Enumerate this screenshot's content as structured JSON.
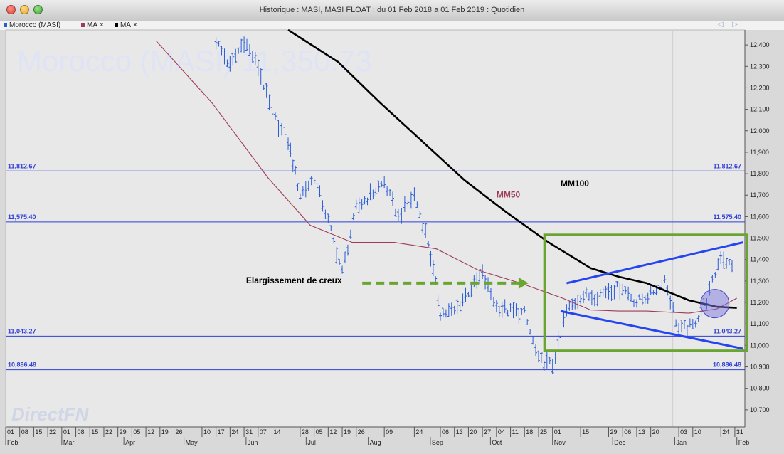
{
  "window": {
    "title": "Historique : MASI, MASI FLOAT : du 01 Feb 2018 a 01 Feb 2019 : Quotidien"
  },
  "legend": {
    "items": [
      {
        "label": "Morocco (MASI)",
        "color": "#2a5bd7"
      },
      {
        "label": "MA",
        "close": "×",
        "color": "#9e3b58"
      },
      {
        "label": "MA",
        "close": "×",
        "color": "#000000"
      }
    ],
    "nav": "◁ ▷"
  },
  "chart_data": {
    "type": "line",
    "title": "Morocco (MASI) 11,350.73",
    "brand": "DirectFN",
    "ylim": [
      10620,
      12470
    ],
    "yticks": [
      12400,
      12300,
      12200,
      12100,
      12000,
      11900,
      11800,
      11700,
      11600,
      11500,
      11400,
      11300,
      11200,
      11100,
      11000,
      10900,
      10800,
      10700
    ],
    "ytick_labels": [
      "12,400",
      "12,300",
      "12,200",
      "12,100",
      "12,000",
      "11,900",
      "11,800",
      "11,700",
      "11,600",
      "11,500",
      "11,400",
      "11,300",
      "11,200",
      "11,100",
      "11,000",
      "10,900",
      "10,800",
      "10,700"
    ],
    "x_day_ticks": [
      "01",
      "08",
      "15",
      "22",
      "01",
      "08",
      "15",
      "22",
      "29",
      "05",
      "12",
      "19",
      "26",
      "10",
      "17",
      "24",
      "31",
      "07",
      "14",
      "28",
      "05",
      "12",
      "19",
      "26",
      "09",
      "24",
      "06",
      "13",
      "20",
      "27",
      "04",
      "11",
      "18",
      "25",
      "01",
      "15",
      "29",
      "06",
      "13",
      "20",
      "03",
      "10",
      "24",
      "31"
    ],
    "x_months": [
      "Feb",
      "Mar",
      "Apr",
      "May",
      "Jun",
      "Jul",
      "Aug",
      "Sep",
      "Oct",
      "Nov",
      "Dec",
      "Jan",
      "Feb"
    ],
    "levels": [
      {
        "value": 11812.67,
        "label": "11,812.67"
      },
      {
        "value": 11575.4,
        "label": "11,575.40"
      },
      {
        "value": 11043.27,
        "label": "11,043.27"
      },
      {
        "value": 10886.48,
        "label": "10,886.48"
      }
    ],
    "series": [
      {
        "name": "Morocco (MASI)",
        "style": "ohlc",
        "color": "#2a5bd7",
        "x": [
          "2018-05-17",
          "2018-05-24",
          "2018-05-31",
          "2018-06-07",
          "2018-06-14",
          "2018-06-22",
          "2018-06-28",
          "2018-07-05",
          "2018-07-12",
          "2018-07-19",
          "2018-07-26",
          "2018-08-02",
          "2018-08-09",
          "2018-08-16",
          "2018-08-24",
          "2018-08-31",
          "2018-09-06",
          "2018-09-13",
          "2018-09-20",
          "2018-09-27",
          "2018-10-04",
          "2018-10-11",
          "2018-10-18",
          "2018-10-25",
          "2018-11-01",
          "2018-11-08",
          "2018-11-15",
          "2018-11-22",
          "2018-11-29",
          "2018-12-06",
          "2018-12-13",
          "2018-12-20",
          "2018-12-27",
          "2019-01-03",
          "2019-01-10",
          "2019-01-17",
          "2019-01-24",
          "2019-01-31"
        ],
        "y": [
          12420,
          12300,
          12420,
          12300,
          12080,
          11950,
          11700,
          11780,
          11580,
          11340,
          11640,
          11700,
          11760,
          11600,
          11700,
          11480,
          11150,
          11160,
          11250,
          11330,
          11180,
          11160,
          11150,
          10930,
          10910,
          11160,
          11230,
          11230,
          11260,
          11270,
          11200,
          11240,
          11310,
          11070,
          11090,
          11210,
          11420,
          11350
        ]
      },
      {
        "name": "MM50",
        "style": "line",
        "color": "#9e3b58",
        "x": [
          "2018-04-17",
          "2018-05-15",
          "2018-06-12",
          "2018-07-03",
          "2018-07-24",
          "2018-08-14",
          "2018-09-04",
          "2018-09-25",
          "2018-10-16",
          "2018-11-06",
          "2018-11-20",
          "2018-12-04",
          "2018-12-18",
          "2019-01-08",
          "2019-01-22",
          "2019-02-01"
        ],
        "y": [
          12420,
          12130,
          11780,
          11560,
          11480,
          11480,
          11450,
          11350,
          11290,
          11220,
          11165,
          11160,
          11160,
          11150,
          11170,
          11220
        ]
      },
      {
        "name": "MM100",
        "style": "line",
        "color": "#000000",
        "x": [
          "2018-06-22",
          "2018-07-17",
          "2018-08-07",
          "2018-08-28",
          "2018-09-18",
          "2018-10-09",
          "2018-10-30",
          "2018-11-20",
          "2018-12-04",
          "2018-12-18",
          "2019-01-08",
          "2019-01-22",
          "2019-02-01"
        ],
        "y": [
          12470,
          12320,
          12130,
          11950,
          11770,
          11620,
          11480,
          11360,
          11320,
          11290,
          11210,
          11180,
          11175
        ]
      }
    ],
    "annotations": [
      {
        "text": "MM50",
        "color": "#9e3b58",
        "x": "2018-10-04",
        "y": 11690
      },
      {
        "text": "MM100",
        "color": "#000000",
        "x": "2018-11-05",
        "y": 11740
      },
      {
        "text": "Elargissement de creux",
        "color": "#000000",
        "x": "2018-06-01",
        "y": 11290
      }
    ],
    "drawings": {
      "box": {
        "x0": "2018-10-28",
        "x1": "2019-02-06",
        "y0": 10975,
        "y1": 11515,
        "color": "#6aa531"
      },
      "upper_trendline": {
        "x0": "2018-11-08",
        "y0": 11290,
        "x1": "2019-02-04",
        "y1": 11480,
        "color": "#2545f0"
      },
      "lower_trendline": {
        "x0": "2018-11-05",
        "y0": 11160,
        "x1": "2019-02-04",
        "y1": 10985,
        "color": "#2545f0"
      },
      "arrow": {
        "x0": "2018-07-29",
        "x1": "2018-10-20",
        "y": 11290,
        "color": "#6aa531",
        "dashed": true
      },
      "circle": {
        "x": "2019-01-21",
        "y": 11195,
        "color": "#7d78e0"
      }
    }
  }
}
